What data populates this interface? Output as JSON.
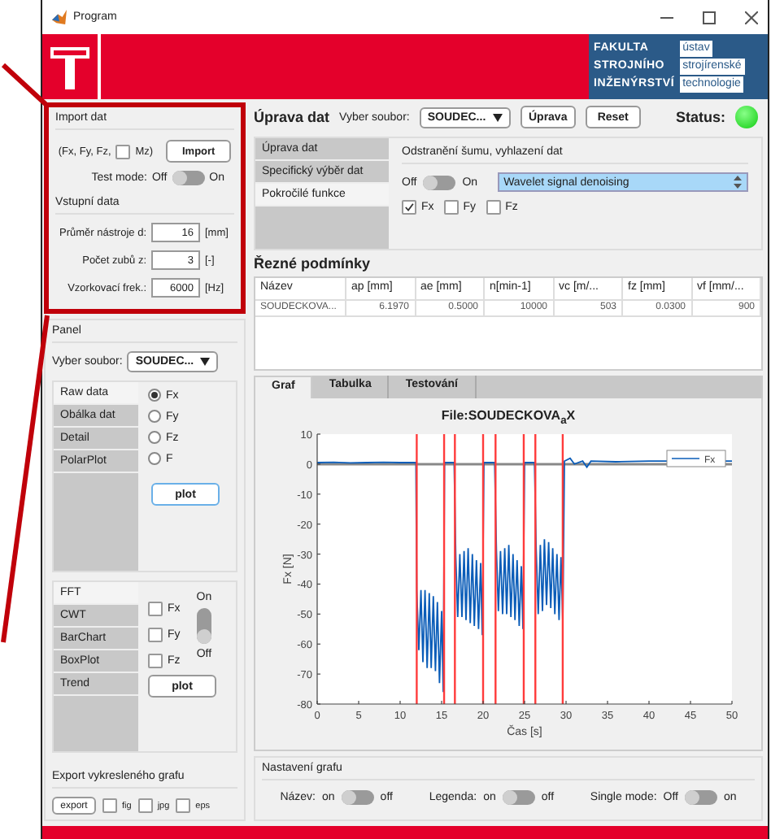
{
  "window": {
    "title": "Program"
  },
  "banner": {
    "faculty": [
      "FAKULTA",
      "STROJNÍHO",
      "INŽENÝRSTVÍ"
    ],
    "department": [
      "ústav",
      "strojírenské",
      "technologie"
    ]
  },
  "import_panel": {
    "title": "Import dat",
    "channels_label": "(Fx, Fy, Fz,",
    "mz": {
      "label": "Mz)",
      "checked": false
    },
    "import_button": "Import",
    "test_mode": {
      "label": "Test mode:",
      "off": "Off",
      "on_label": "On",
      "on": false
    }
  },
  "input_data": {
    "title": "Vstupní data",
    "fields": [
      {
        "label": "Průměr nástroje d:",
        "value": "16",
        "unit": "[mm]"
      },
      {
        "label": "Počet zubů z:",
        "value": "3",
        "unit": "[-]"
      },
      {
        "label": "Vzorkovací frek.:",
        "value": "6000",
        "unit": "[Hz]"
      }
    ]
  },
  "panel": {
    "title": "Panel",
    "file_label": "Vyber soubor:",
    "file_value": "SOUDEC...",
    "raw_tabs": [
      {
        "label": "Raw data",
        "selected": true
      },
      {
        "label": "Obálka dat",
        "selected": false
      },
      {
        "label": "Detail",
        "selected": false
      },
      {
        "label": "PolarPlot",
        "selected": false
      }
    ],
    "channels": [
      {
        "label": "Fx",
        "selected": true
      },
      {
        "label": "Fy",
        "selected": false
      },
      {
        "label": "Fz",
        "selected": false
      },
      {
        "label": "F",
        "selected": false
      }
    ],
    "plot_button": "plot",
    "analysis_tabs": [
      {
        "label": "FFT",
        "selected": true
      },
      {
        "label": "CWT",
        "selected": false
      },
      {
        "label": "BarChart",
        "selected": false
      },
      {
        "label": "BoxPlot",
        "selected": false
      },
      {
        "label": "Trend",
        "selected": false
      }
    ],
    "analysis_checks": [
      {
        "label": "Fx",
        "checked": false
      },
      {
        "label": "Fy",
        "checked": false
      },
      {
        "label": "Fz",
        "checked": false
      }
    ],
    "switch": {
      "on_label": "On",
      "off_label": "Off",
      "on": false
    },
    "analysis_plot_button": "plot"
  },
  "export": {
    "title": "Export vykresleného grafu",
    "button": "export",
    "formats": [
      {
        "label": "fig",
        "checked": false
      },
      {
        "label": "jpg",
        "checked": false
      },
      {
        "label": "eps",
        "checked": false
      }
    ]
  },
  "editing": {
    "title": "Úprava dat",
    "file_label": "Vyber soubor:",
    "file_value": "SOUDEC...",
    "buttons": [
      "Úprava",
      "Reset"
    ],
    "status": {
      "label": "Status:",
      "ok": true
    }
  },
  "side_tabs": [
    {
      "label": "Úprava dat",
      "selected": false
    },
    {
      "label": "Specifický výběr dat",
      "selected": false
    },
    {
      "label": "Pokročilé funkce",
      "selected": true
    }
  ],
  "denoise": {
    "title": "Odstranění šumu, vyhlazení dat",
    "toggle": {
      "off": "Off",
      "on_label": "On",
      "on": false
    },
    "method": "Wavelet signal denoising",
    "checks": [
      {
        "label": "Fx",
        "checked": true
      },
      {
        "label": "Fy",
        "checked": false
      },
      {
        "label": "Fz",
        "checked": false
      }
    ]
  },
  "conditions": {
    "title": "Řezné podmínky",
    "columns": [
      "Název",
      "ap [mm]",
      "ae [mm]",
      "n[min-1]",
      "vc [m/...",
      "fz [mm]",
      "vf [mm/..."
    ],
    "rows": [
      [
        "SOUDECKOVA...",
        "6.1970",
        "0.5000",
        "10000",
        "503",
        "0.0300",
        "900"
      ]
    ]
  },
  "graph_tabs": [
    {
      "label": "Graf",
      "selected": true
    },
    {
      "label": "Tabulka",
      "selected": false
    },
    {
      "label": "Testování",
      "selected": false
    }
  ],
  "chart_data": {
    "type": "line",
    "title": "File:SOUDECKOVA$_{a}$X",
    "xlabel": "Čas [s]",
    "ylabel": "Fx [N]",
    "xlim": [
      0,
      50
    ],
    "ylim": [
      -80,
      10
    ],
    "xticks": [
      0,
      5,
      10,
      15,
      20,
      25,
      30,
      35,
      40,
      45,
      50
    ],
    "yticks": [
      10,
      0,
      -10,
      -20,
      -30,
      -40,
      -50,
      -60,
      -70,
      -80
    ],
    "x": [
      0,
      2,
      4,
      6,
      8,
      10,
      11.9,
      12.0,
      12.25,
      12.5,
      12.75,
      13.0,
      13.25,
      13.5,
      13.75,
      14.0,
      14.25,
      14.5,
      14.75,
      15.0,
      15.2,
      15.35,
      16.5,
      16.7,
      16.95,
      17.2,
      17.45,
      17.7,
      17.95,
      18.2,
      18.45,
      18.7,
      18.95,
      19.2,
      19.45,
      19.7,
      19.9,
      20.1,
      21.4,
      21.6,
      21.85,
      22.1,
      22.35,
      22.6,
      22.85,
      23.1,
      23.35,
      23.6,
      23.85,
      24.1,
      24.35,
      24.6,
      24.8,
      25.0,
      26.2,
      26.4,
      26.65,
      26.9,
      27.15,
      27.4,
      27.65,
      27.9,
      28.15,
      28.4,
      28.65,
      28.9,
      29.15,
      29.4,
      29.6,
      29.8,
      30.5,
      31,
      32,
      32.5,
      33,
      36,
      40,
      45,
      50
    ],
    "series": [
      {
        "name": "Fx",
        "color": "#0a5cb8",
        "values": [
          0.5,
          0.6,
          0.4,
          0.5,
          0.6,
          0.5,
          0.5,
          -42,
          -62,
          -42,
          -66,
          -42,
          -68,
          -43,
          -68,
          -44,
          -69,
          -46,
          -73,
          -49,
          -76,
          0.5,
          0.5,
          -31,
          -51,
          -30,
          -51,
          -29,
          -52,
          -28,
          -53,
          -30,
          -54,
          -32,
          -55,
          -33,
          -57,
          0.5,
          0.5,
          -29,
          -49,
          -29,
          -50,
          -28,
          -50,
          -27,
          -51,
          -30,
          -52,
          -32,
          -54,
          -34,
          -55,
          0.5,
          0.5,
          -28,
          -50,
          -27,
          -49,
          -25,
          -47,
          -26,
          -48,
          -28,
          -50,
          -30,
          -52,
          -31,
          -53,
          1,
          2,
          0,
          1,
          -1,
          1,
          0.8,
          1,
          1,
          1
        ]
      }
    ],
    "ref_lines": [
      {
        "axis": "x",
        "value": 12
      },
      {
        "axis": "x",
        "value": 15.3
      },
      {
        "axis": "x",
        "value": 16.6
      },
      {
        "axis": "x",
        "value": 20
      },
      {
        "axis": "x",
        "value": 21.5
      },
      {
        "axis": "x",
        "value": 24.9
      },
      {
        "axis": "x",
        "value": 26.3
      },
      {
        "axis": "x",
        "value": 29.6
      }
    ]
  },
  "graph_settings": {
    "title": "Nastavení grafu",
    "toggles": [
      {
        "label": "Název:",
        "left": "on",
        "right": "off",
        "on": false
      },
      {
        "label": "Legenda:",
        "left": "on",
        "right": "off",
        "on": false
      },
      {
        "label": "Single mode:",
        "left": "Off",
        "right": "on",
        "on": false
      }
    ]
  }
}
